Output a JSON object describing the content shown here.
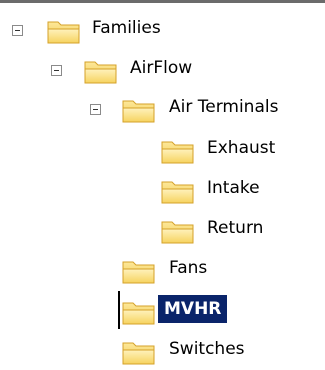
{
  "tree": {
    "items": [
      {
        "label": "Families",
        "level": 0,
        "expanded": true,
        "selected": false
      },
      {
        "label": "AirFlow",
        "level": 1,
        "expanded": true,
        "selected": false
      },
      {
        "label": "Air Terminals",
        "level": 2,
        "expanded": true,
        "selected": false
      },
      {
        "label": "Exhaust",
        "level": 3,
        "expanded": false,
        "selected": false
      },
      {
        "label": "Intake",
        "level": 3,
        "expanded": false,
        "selected": false
      },
      {
        "label": "Return",
        "level": 3,
        "expanded": false,
        "selected": false
      },
      {
        "label": "Fans",
        "level": 2,
        "expanded": false,
        "selected": false
      },
      {
        "label": "MVHR",
        "level": 2,
        "expanded": false,
        "selected": true
      },
      {
        "label": "Switches",
        "level": 2,
        "expanded": false,
        "selected": false
      }
    ]
  },
  "icons": {
    "expander": "collapse-minus-icon",
    "folder": "folder-icon"
  },
  "colors": {
    "selection_background": "#0a246a",
    "selection_text": "#ffffff",
    "folder_fill": "#f7d55e",
    "folder_edge": "#d9a622"
  }
}
